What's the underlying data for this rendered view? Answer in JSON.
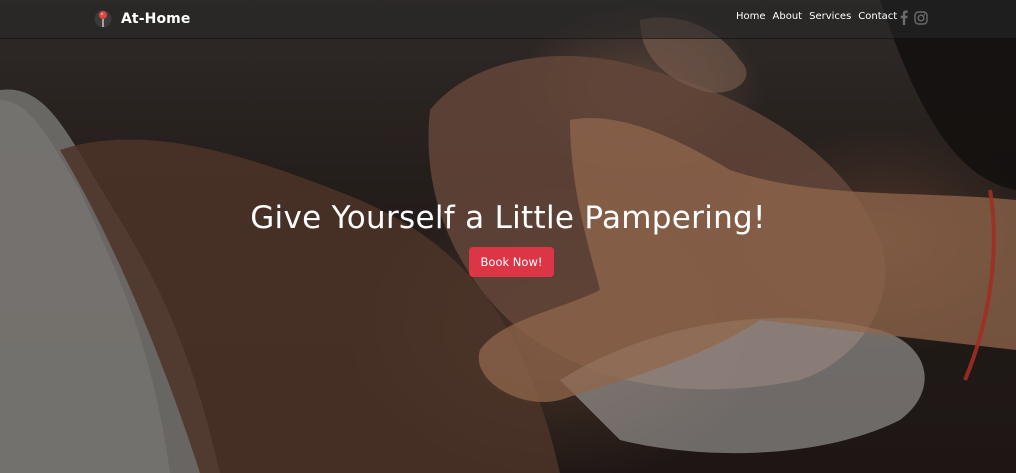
{
  "brand": {
    "name": "At-Home",
    "logo_icon": "spa-pin-icon"
  },
  "nav": {
    "items": [
      {
        "label": "Home"
      },
      {
        "label": "About"
      },
      {
        "label": "Services"
      },
      {
        "label": "Contact"
      }
    ]
  },
  "social": [
    {
      "icon": "facebook-icon"
    },
    {
      "icon": "instagram-icon"
    }
  ],
  "hero": {
    "headline": "Give Yourself a Little Pampering!",
    "cta_label": "Book Now!",
    "background_image": "facial-massage-photo"
  },
  "colors": {
    "accent": "#dc3545",
    "navbar_bg": "#282828",
    "text": "#ffffff"
  }
}
